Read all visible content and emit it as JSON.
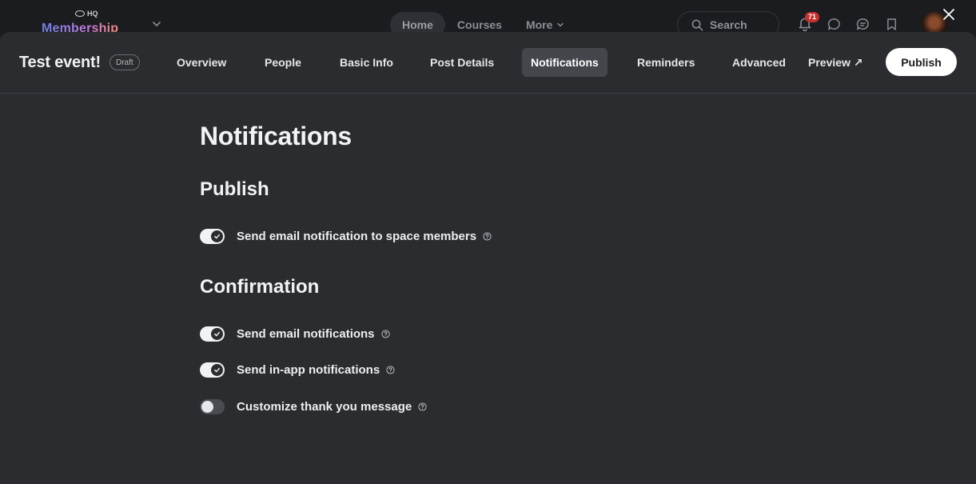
{
  "app": {
    "brand_top": "HQ",
    "brand_name": "Membership",
    "nav": [
      {
        "label": "Home"
      },
      {
        "label": "Courses"
      },
      {
        "label": "More"
      }
    ],
    "search_placeholder": "Search",
    "notification_count": "71"
  },
  "editor": {
    "title": "Test event!",
    "status_badge": "Draft",
    "tabs": [
      {
        "label": "Overview"
      },
      {
        "label": "People"
      },
      {
        "label": "Basic Info"
      },
      {
        "label": "Post Details"
      },
      {
        "label": "Notifications"
      },
      {
        "label": "Reminders"
      },
      {
        "label": "Advanced"
      },
      {
        "label": "Preview ↗"
      }
    ],
    "active_tab": "Notifications",
    "publish_label": "Publish"
  },
  "notifications": {
    "heading": "Notifications",
    "sections": [
      {
        "title": "Publish",
        "settings": [
          {
            "label": "Send email notification to space members",
            "enabled": true
          }
        ]
      },
      {
        "title": "Confirmation",
        "settings": [
          {
            "label": "Send email notifications",
            "enabled": true
          },
          {
            "label": "Send in-app notifications",
            "enabled": true
          },
          {
            "label": "Customize thank you message",
            "enabled": false
          }
        ]
      }
    ]
  },
  "colors": {
    "panel_bg": "#2a2c30",
    "page_bg": "#1a1b1f",
    "toggle_on": "#f2f3f5",
    "toggle_off": "#4a4c52",
    "badge_red": "#c7302c"
  }
}
